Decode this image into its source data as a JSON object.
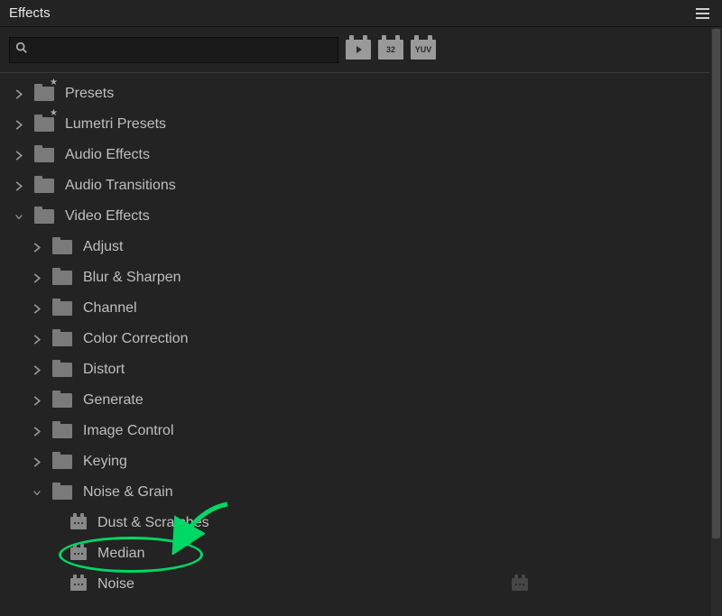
{
  "panel": {
    "title": "Effects",
    "search_placeholder": ""
  },
  "filters": {
    "fx": "▶",
    "n32": "32",
    "yuv": "YUV"
  },
  "tree": {
    "presets": "Presets",
    "lumetri_presets": "Lumetri Presets",
    "audio_effects": "Audio Effects",
    "audio_transitions": "Audio Transitions",
    "video_effects": "Video Effects",
    "children": {
      "adjust": "Adjust",
      "blur_sharpen": "Blur & Sharpen",
      "channel": "Channel",
      "color_correction": "Color Correction",
      "distort": "Distort",
      "generate": "Generate",
      "image_control": "Image Control",
      "keying": "Keying",
      "noise_grain": "Noise & Grain",
      "leaves": {
        "dust_scratches": "Dust & Scratches",
        "median": "Median",
        "noise": "Noise"
      }
    }
  }
}
